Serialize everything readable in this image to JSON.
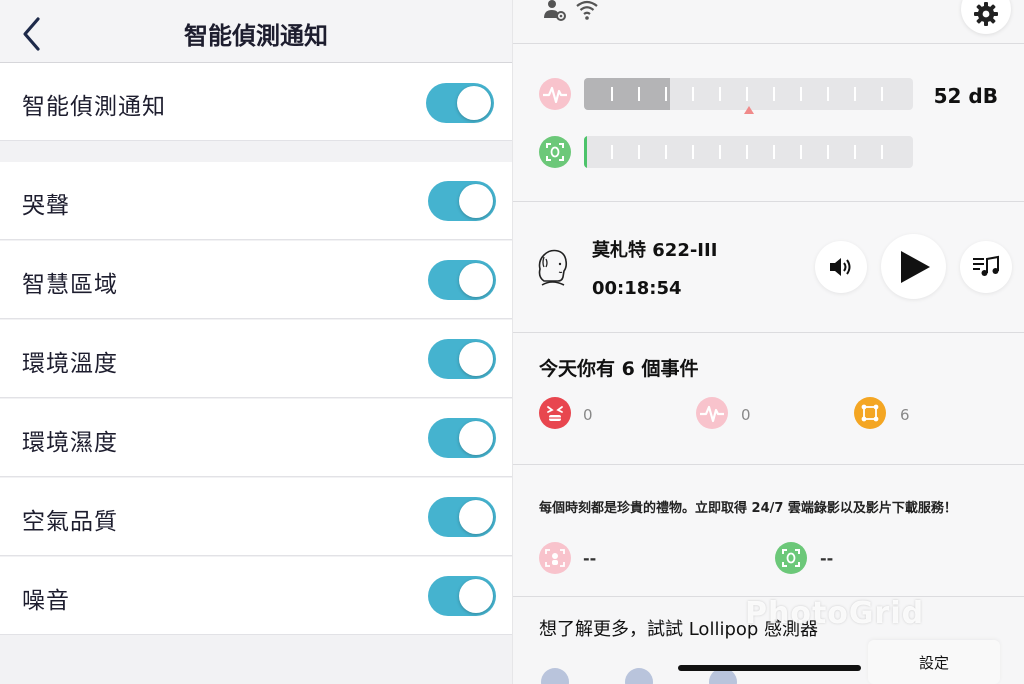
{
  "left": {
    "nav_title": "智能偵測通知",
    "master": {
      "label": "智能偵測通知",
      "on": true
    },
    "items": [
      {
        "label": "哭聲",
        "on": true
      },
      {
        "label": "智慧區域",
        "on": true
      },
      {
        "label": "環境溫度",
        "on": true
      },
      {
        "label": "環境濕度",
        "on": true
      },
      {
        "label": "空氣品質",
        "on": true
      },
      {
        "label": "噪音",
        "on": true
      }
    ]
  },
  "right": {
    "sound_level": "52 dB",
    "track": {
      "title": "莫札特 622-III",
      "elapsed": "00:18:54"
    },
    "events": {
      "title": "今天你有 6 個事件",
      "items": [
        {
          "icon": "crying-face-icon",
          "count": "0",
          "color": "#e8464f"
        },
        {
          "icon": "sound-wave-icon",
          "count": "0",
          "color": "#f5a6b2"
        },
        {
          "icon": "zone-icon",
          "count": "6",
          "color": "#f4a623"
        }
      ]
    },
    "promo": "每個時刻都是珍貴的禮物。立即取得 24/7 雲端錄影以及影片下載服務！",
    "cloud": [
      {
        "icon": "baby-detect-icon",
        "value": "--",
        "color": "#f5a6b2"
      },
      {
        "icon": "face-scan-icon",
        "value": "--",
        "color": "#6cc879"
      }
    ],
    "learn_more": "想了解更多，試試 Lollipop 感測器",
    "watermark": "PhotoGrid",
    "settings_label": "設定"
  },
  "colors": {
    "toggle_on": "#45b3cf",
    "accent_pink": "#f5a6b2",
    "accent_green": "#6cc879",
    "accent_orange": "#f4a623",
    "accent_red": "#e8464f"
  }
}
